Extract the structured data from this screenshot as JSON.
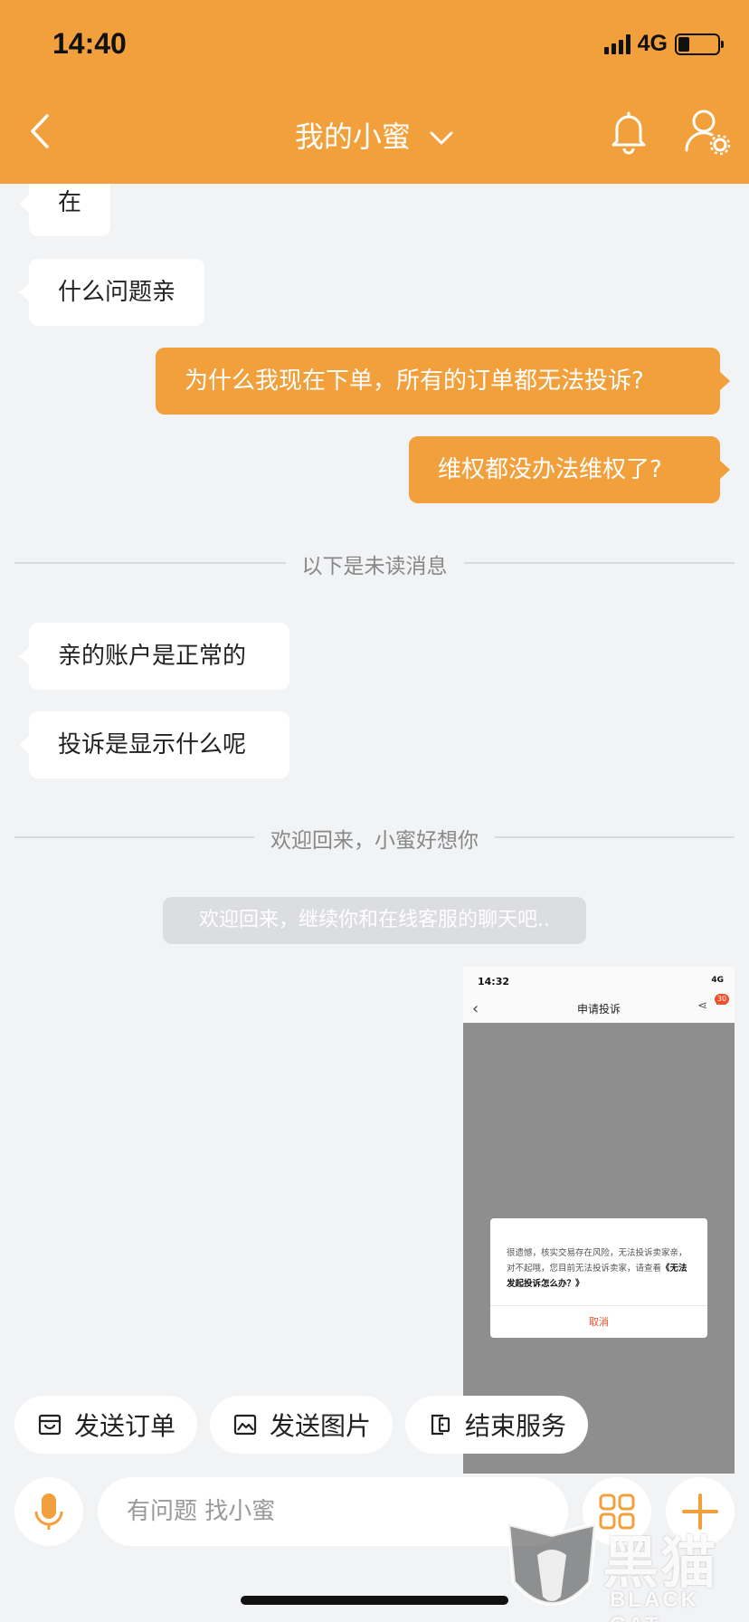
{
  "status_bar": {
    "time": "14:40",
    "network": "4G"
  },
  "nav": {
    "title": "我的小蜜"
  },
  "messages": [
    {
      "side": "left",
      "text": "在"
    },
    {
      "side": "left",
      "text": "什么问题亲"
    },
    {
      "side": "right",
      "text": "为什么我现在下单，所有的订单都无法投诉?"
    },
    {
      "side": "right",
      "text": "维权都没办法维权了?"
    },
    {
      "side": "left",
      "text": "亲的账户是正常的"
    },
    {
      "side": "left",
      "text": "投诉是显示什么呢"
    }
  ],
  "dividers": {
    "unread": "以下是未读消息",
    "welcome": "欢迎回来，小蜜好想你"
  },
  "system_notice": "欢迎回来，继续你和在线客服的聊天吧..",
  "screenshot": {
    "time": "14:32",
    "status": "4G",
    "title": "申请投诉",
    "badge": "30",
    "dialog_text": "很遗憾，核实交易存在风险，无法投诉卖家亲，对不起哦，您目前无法投诉卖家，请查看",
    "dialog_link": "《无法发起投诉怎么办？》",
    "dialog_cancel": "取消"
  },
  "quick_actions": [
    {
      "label": "发送订单",
      "icon": "order-box-icon"
    },
    {
      "label": "发送图片",
      "icon": "image-icon"
    },
    {
      "label": "结束服务",
      "icon": "exit-icon"
    }
  ],
  "input": {
    "placeholder": "有问题 找小蜜"
  },
  "watermark": {
    "cn": "黑猫",
    "en": "BLACK CAT"
  },
  "colors": {
    "accent": "#f2a03c",
    "background": "#f2f3f5",
    "bubble_left": "#ffffff",
    "alert": "#f1502a"
  }
}
